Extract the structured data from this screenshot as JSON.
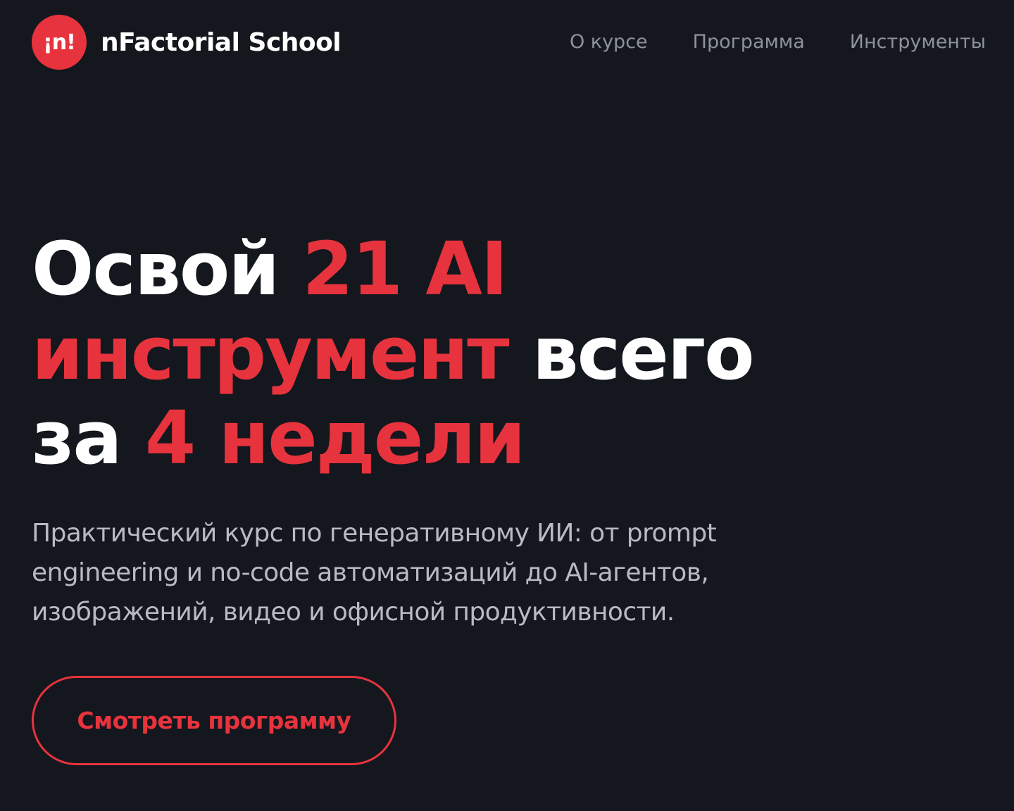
{
  "header": {
    "logo_mark": "¡n!",
    "logo_text": "nFactorial School",
    "nav": [
      {
        "label": "О курсе"
      },
      {
        "label": "Программа"
      },
      {
        "label": "Инструменты"
      }
    ]
  },
  "hero": {
    "title": {
      "line1_white": "Освой ",
      "line1_accent": "21 AI",
      "line2_accent": "инструмент",
      "line2_white": " всего",
      "line3_white": "за ",
      "line3_accent": "4 недели"
    },
    "subtitle": {
      "line1": "Практический курс по генеративному ИИ: от prompt",
      "line2": "engineering и no-code автоматизаций до AI-агентов,",
      "line3": "изображений, видео и офисной продуктивности."
    },
    "cta_label": "Смотреть программу"
  },
  "colors": {
    "background": "#14171e",
    "accent": "#e7333d",
    "nav_text": "#8e929b",
    "subtitle_text": "#b8bbc2",
    "title_text": "#ffffff"
  }
}
